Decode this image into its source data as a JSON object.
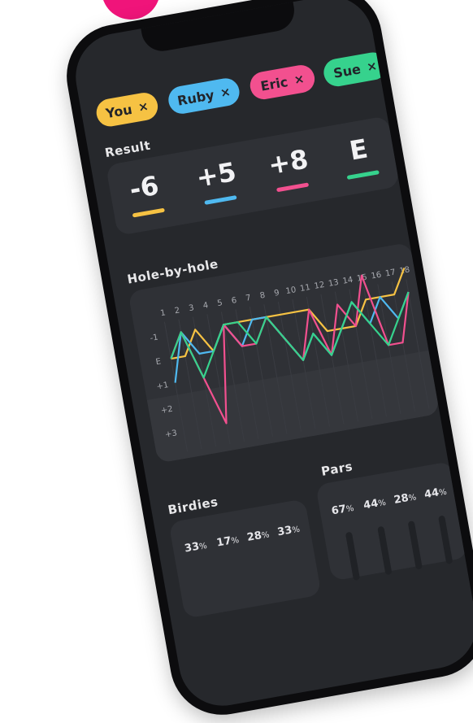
{
  "players": [
    {
      "name": "You",
      "color": "#f6c243",
      "score": "-6"
    },
    {
      "name": "Ruby",
      "color": "#4fb9f0",
      "score": "+5"
    },
    {
      "name": "Eric",
      "color": "#f2508f",
      "score": "+8"
    },
    {
      "name": "Sue",
      "color": "#36d28d",
      "score": "E"
    }
  ],
  "chip_close_glyph": "×",
  "result_label": "Result",
  "hole_label": "Hole-by-hole",
  "birdies_label": "Birdies",
  "pars_label": "Pars",
  "birdies_pcts": [
    "33",
    "17",
    "28",
    "33"
  ],
  "pars_pcts": [
    "67",
    "44",
    "28",
    "44"
  ],
  "pct_sign": "%",
  "chart_data": {
    "type": "line",
    "x": [
      1,
      2,
      3,
      4,
      5,
      6,
      7,
      8,
      9,
      10,
      11,
      12,
      13,
      14,
      15,
      16,
      17,
      18
    ],
    "y_ticks": [
      "-1",
      "E",
      "+1",
      "+2",
      "+3"
    ],
    "ylim": [
      -1,
      3
    ],
    "series": [
      {
        "color": "#f6c243",
        "values": [
          0,
          0,
          -1,
          0,
          -1,
          -1,
          -1,
          -1,
          -1,
          -1,
          -1,
          0,
          0,
          0,
          -1,
          -1,
          -1,
          -2
        ]
      },
      {
        "color": "#4fb9f0",
        "values": [
          1,
          -1,
          0,
          0,
          -1,
          0,
          -1,
          -1,
          0,
          1,
          0,
          1,
          0,
          -1,
          0,
          -1,
          0,
          -1
        ]
      },
      {
        "color": "#f2508f",
        "values": [
          0,
          -1,
          1,
          3,
          -1,
          0,
          0,
          -1,
          0,
          1,
          -1,
          1,
          -1,
          0,
          -2,
          1,
          1,
          -1
        ]
      },
      {
        "color": "#36d28d",
        "values": [
          0,
          -1,
          1,
          0,
          -1,
          -1,
          0,
          -1,
          0,
          1,
          0,
          1,
          0,
          -1,
          0,
          1,
          0,
          -1
        ]
      }
    ]
  }
}
